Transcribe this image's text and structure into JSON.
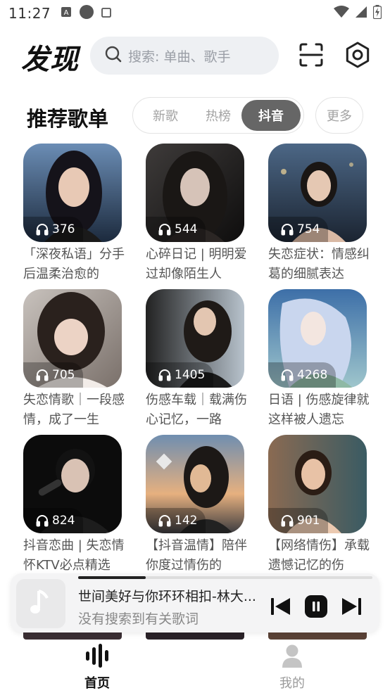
{
  "status_bar": {
    "time": "11:27",
    "icons": [
      "app-notification-icon",
      "circle-icon",
      "square-icon",
      "wifi-icon",
      "signal-icon",
      "battery-icon"
    ]
  },
  "header": {
    "title": "发现",
    "search_placeholder": "搜索: 单曲、歌手",
    "icons": [
      "scan-icon",
      "settings-icon"
    ]
  },
  "section": {
    "title": "推荐歌单",
    "tabs": [
      {
        "label": "新歌",
        "active": false
      },
      {
        "label": "热榜",
        "active": false
      },
      {
        "label": "抖音",
        "active": true
      }
    ],
    "more_label": "更多"
  },
  "playlists": [
    {
      "plays": "376",
      "title": "「深夜私语」分手后温柔治愈的"
    },
    {
      "plays": "544",
      "title": "心碎日记 | 明明爱过却像陌生人"
    },
    {
      "plays": "754",
      "title": "失恋症状：情感纠葛的细腻表达"
    },
    {
      "plays": "705",
      "title": "失恋情歌｜一段感情，成了一生"
    },
    {
      "plays": "1405",
      "title": "伤感车载｜载满伤心记忆，一路"
    },
    {
      "plays": "4268",
      "title": "日语 | 伤感旋律就这样被人遗忘"
    },
    {
      "plays": "824",
      "title": "抖音恋曲 | 失恋情怀KTV必点精选"
    },
    {
      "plays": "142",
      "title": "【抖音温情】陪伴你度过情伤的"
    },
    {
      "plays": "901",
      "title": "【网络情伤】承载遗憾记忆的伤"
    }
  ],
  "player": {
    "song": "世间美好与你环环相扣-林大...",
    "lyric_status": "没有搜索到有关歌词",
    "progress": 0.23,
    "icons": [
      "music-note-icon",
      "previous-icon",
      "pause-icon",
      "next-icon"
    ]
  },
  "bottom_nav": [
    {
      "label": "首页",
      "active": true,
      "icon": "home-sound-icon"
    },
    {
      "label": "我的",
      "active": false,
      "icon": "person-icon"
    }
  ],
  "colors": {
    "active_tab": "#666666",
    "nav_active": "#111111",
    "nav_inactive": "#9a9a9a"
  }
}
